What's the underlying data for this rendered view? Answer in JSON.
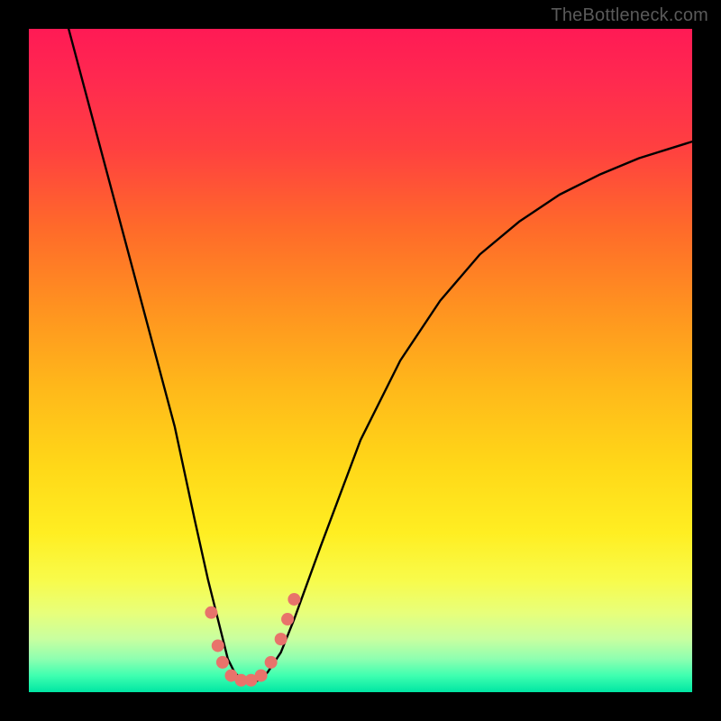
{
  "attribution": "TheBottleneck.com",
  "chart_data": {
    "type": "line",
    "title": "",
    "xlabel": "",
    "ylabel": "",
    "xlim": [
      0,
      100
    ],
    "ylim": [
      0,
      100
    ],
    "grid": false,
    "legend": false,
    "series": [
      {
        "name": "curve",
        "x": [
          6,
          10,
          14,
          18,
          22,
          25,
          27,
          29,
          30,
          31,
          32,
          33,
          34,
          35,
          36,
          38,
          40,
          44,
          50,
          56,
          62,
          68,
          74,
          80,
          86,
          92,
          100
        ],
        "values": [
          100,
          85,
          70,
          55,
          40,
          26,
          17,
          9,
          5,
          3,
          2,
          1.5,
          1.5,
          2,
          3,
          6,
          11,
          22,
          38,
          50,
          59,
          66,
          71,
          75,
          78,
          80.5,
          83
        ]
      }
    ],
    "markers": {
      "color": "#e8736b",
      "radius_px": 7,
      "points": [
        {
          "x": 27.5,
          "y": 12
        },
        {
          "x": 28.5,
          "y": 7
        },
        {
          "x": 29.2,
          "y": 4.5
        },
        {
          "x": 30.5,
          "y": 2.5
        },
        {
          "x": 32.0,
          "y": 1.8
        },
        {
          "x": 33.5,
          "y": 1.8
        },
        {
          "x": 35.0,
          "y": 2.5
        },
        {
          "x": 36.5,
          "y": 4.5
        },
        {
          "x": 38.0,
          "y": 8
        },
        {
          "x": 39.0,
          "y": 11
        },
        {
          "x": 40.0,
          "y": 14
        }
      ]
    }
  }
}
